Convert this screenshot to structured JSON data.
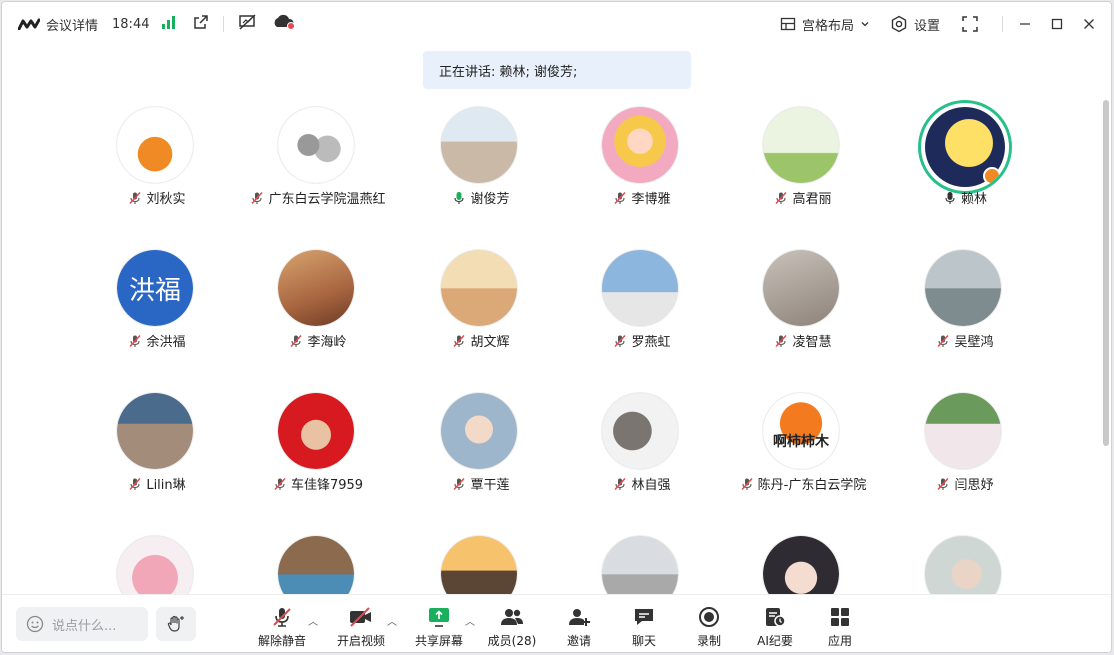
{
  "titlebar": {
    "meeting_details": "会议详情",
    "time": "18:44",
    "layout_label": "宫格布局",
    "settings_label": "设置"
  },
  "speaking": {
    "text": "正在讲话: 赖林; 谢俊芳;"
  },
  "participants": [
    {
      "name": "刘秋实",
      "mic": "muted",
      "avatar": "persimmon"
    },
    {
      "name": "广东白云学院温燕红",
      "mic": "muted",
      "avatar": "cats"
    },
    {
      "name": "谢俊芳",
      "mic": "speaking",
      "avatar": "beach"
    },
    {
      "name": "李博雅",
      "mic": "muted",
      "avatar": "anime"
    },
    {
      "name": "高君丽",
      "mic": "muted",
      "avatar": "cartoon"
    },
    {
      "name": "赖林",
      "mic": "active",
      "avatar": "moon",
      "active": true
    },
    {
      "name": "余洪福",
      "mic": "muted",
      "avatar": "text",
      "avatar_text": "洪福"
    },
    {
      "name": "李海岭",
      "mic": "muted",
      "avatar": "girl"
    },
    {
      "name": "胡文辉",
      "mic": "muted",
      "avatar": "runner"
    },
    {
      "name": "罗燕虹",
      "mic": "muted",
      "avatar": "sky"
    },
    {
      "name": "凌智慧",
      "mic": "muted",
      "avatar": "baby"
    },
    {
      "name": "吴壁鸿",
      "mic": "muted",
      "avatar": "misty"
    },
    {
      "name": "Lilin琳",
      "mic": "muted",
      "avatar": "city"
    },
    {
      "name": "车佳锋7959",
      "mic": "muted",
      "avatar": "portrait"
    },
    {
      "name": "覃干莲",
      "mic": "muted",
      "avatar": "doll"
    },
    {
      "name": "林自强",
      "mic": "muted",
      "avatar": "wolf"
    },
    {
      "name": "陈丹-广东白云学院",
      "mic": "muted",
      "avatar": "persimmon2",
      "avatar_text": "啊柿柿木"
    },
    {
      "name": "闫思妤",
      "mic": "muted",
      "avatar": "garden"
    },
    {
      "name": "",
      "mic": "none",
      "avatar": "flowers"
    },
    {
      "name": "",
      "mic": "none",
      "avatar": "kid"
    },
    {
      "name": "",
      "mic": "none",
      "avatar": "sunset"
    },
    {
      "name": "",
      "mic": "none",
      "avatar": "snow"
    },
    {
      "name": "",
      "mic": "none",
      "avatar": "animegirl"
    },
    {
      "name": "",
      "mic": "none",
      "avatar": "woman"
    }
  ],
  "toolbar": {
    "chat_placeholder": "说点什么...",
    "unmute": "解除静音",
    "start_video": "开启视频",
    "share_screen": "共享屏幕",
    "members": "成员(28)",
    "invite": "邀请",
    "chat": "聊天",
    "record": "录制",
    "ai_minutes": "AI纪要",
    "apps": "应用"
  },
  "colors": {
    "accent": "#1a73e8",
    "active_ring": "#27c08a",
    "speaking_bg": "#e8f0fb",
    "muted_red": "#e5484d",
    "signal_green": "#1aaf5d"
  }
}
